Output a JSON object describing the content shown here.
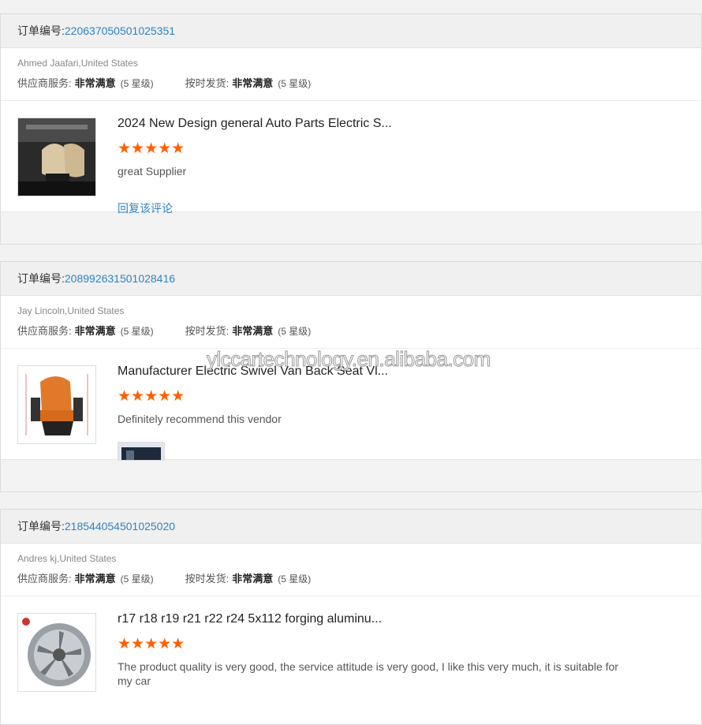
{
  "watermark": "ylccartechnology.en.alibaba.com",
  "orders": [
    {
      "order_label": "订单编号:",
      "order_no": "220637050501025351",
      "buyer": "Ahmed Jaafari,United States",
      "supplier_label": "供应商服务:",
      "supplier_value": "非常满意",
      "supplier_level": "(5 星级)",
      "ship_label": "按时发货:",
      "ship_value": "非常满意",
      "ship_level": "(5 星级)",
      "product_title": "2024 New Design general Auto Parts Electric S...",
      "stars": "★★★★★",
      "review": "great Supplier",
      "reply": "回复该评论"
    },
    {
      "order_label": "订单编号:",
      "order_no": "208992631501028416",
      "buyer": "Jay Lincoln,United States",
      "supplier_label": "供应商服务:",
      "supplier_value": "非常满意",
      "supplier_level": "(5 星级)",
      "ship_label": "按时发货:",
      "ship_value": "非常满意",
      "ship_level": "(5 星级)",
      "product_title": "Manufacturer Electric Swivel Van Back Seat Vl...",
      "stars": "★★★★★",
      "review": "Definitely recommend this vendor"
    },
    {
      "order_label": "订单编号:",
      "order_no": "218544054501025020",
      "buyer": "Andres kj,United States",
      "supplier_label": "供应商服务:",
      "supplier_value": "非常满意",
      "supplier_level": "(5 星级)",
      "ship_label": "按时发货:",
      "ship_value": "非常满意",
      "ship_level": "(5 星级)",
      "product_title": "r17 r18 r19 r21 r22 r24 5x112 forging aluminu...",
      "stars": "★★★★★",
      "review": "The product quality is very good, the service attitude is very good, I like this very much, it is suitable for my car"
    }
  ]
}
